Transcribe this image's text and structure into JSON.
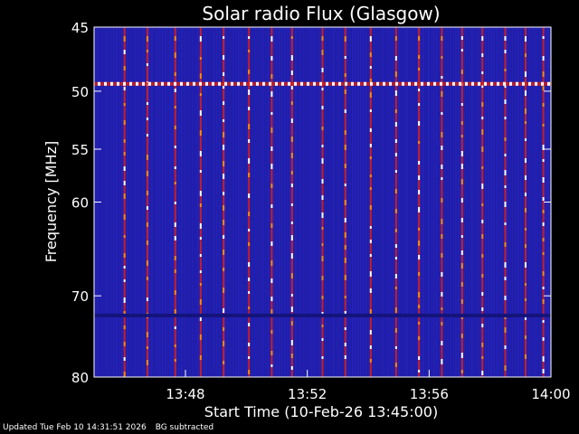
{
  "chart_data": {
    "type": "heatmap",
    "title": "Solar radio Flux (Glasgow)",
    "xlabel": "Start Time (10-Feb-26 13:45:00)",
    "ylabel": "Frequency [MHz]",
    "xlim": [
      "13:45:00",
      "14:00:00"
    ],
    "ylim": [
      45,
      80
    ],
    "y_scale": "log",
    "y_inverted": true,
    "x_ticks": [
      "13:48",
      "13:52",
      "13:56",
      "14:00"
    ],
    "y_ticks": [
      45,
      50,
      55,
      60,
      70,
      80
    ],
    "colormap": [
      "#1a1aa8",
      "#3a2ae0",
      "#8a1a8a",
      "#e02010",
      "#ff8a00",
      "#ffffff"
    ],
    "features": {
      "horizontal_line_mhz": 49.4,
      "band_gap_mhz": 72.3,
      "burst_columns": [
        "13:46:00",
        "13:46:45",
        "13:47:40",
        "13:48:30",
        "13:49:15",
        "13:50:05",
        "13:50:50",
        "13:51:30",
        "13:52:30",
        "13:53:15",
        "13:54:05",
        "13:54:55",
        "13:55:40",
        "13:56:25",
        "13:57:05",
        "13:57:45",
        "13:58:30",
        "13:59:10",
        "13:59:45"
      ]
    }
  },
  "footer": {
    "updated": "Updated Tue Feb 10 14:31:51 2026",
    "note": "BG subtracted"
  }
}
